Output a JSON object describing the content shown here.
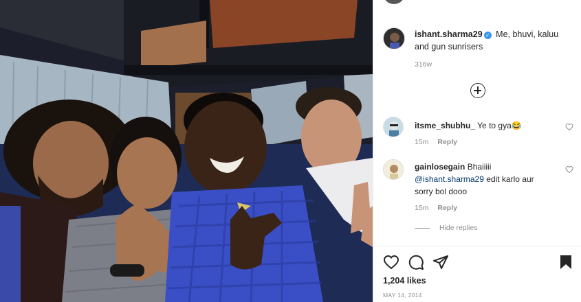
{
  "post": {
    "caption": {
      "username": "ishant.sharma29",
      "verified_badge_icon": "verified-badge-icon",
      "text": "Me, bhuvi, kaluu and gun sunrisers",
      "time": "316w"
    },
    "load_more_icon": "plus-circle-icon",
    "comments": [
      {
        "username": "itsme_shubhu_",
        "text": "Ye to gya😂",
        "time": "15m",
        "reply_label": "Reply"
      },
      {
        "username": "gainlosegain",
        "text_before": "Bhaiiiii",
        "mention": "@ishant.sharma29",
        "text_after": "edit karlo aur sorry bol dooo",
        "time": "15m",
        "reply_label": "Reply"
      }
    ],
    "hide_replies_label": "Hide replies",
    "actions": {
      "like_icon": "heart-icon",
      "comment_icon": "comment-icon",
      "share_icon": "share-icon",
      "save_icon": "bookmark-icon"
    },
    "likes": "1,204 likes",
    "date": "MAY 14, 2014"
  },
  "colors": {
    "text": "#262626",
    "muted": "#8e8e8e",
    "mention": "#00376b",
    "verified": "#3897f0",
    "border": "#efefef"
  }
}
